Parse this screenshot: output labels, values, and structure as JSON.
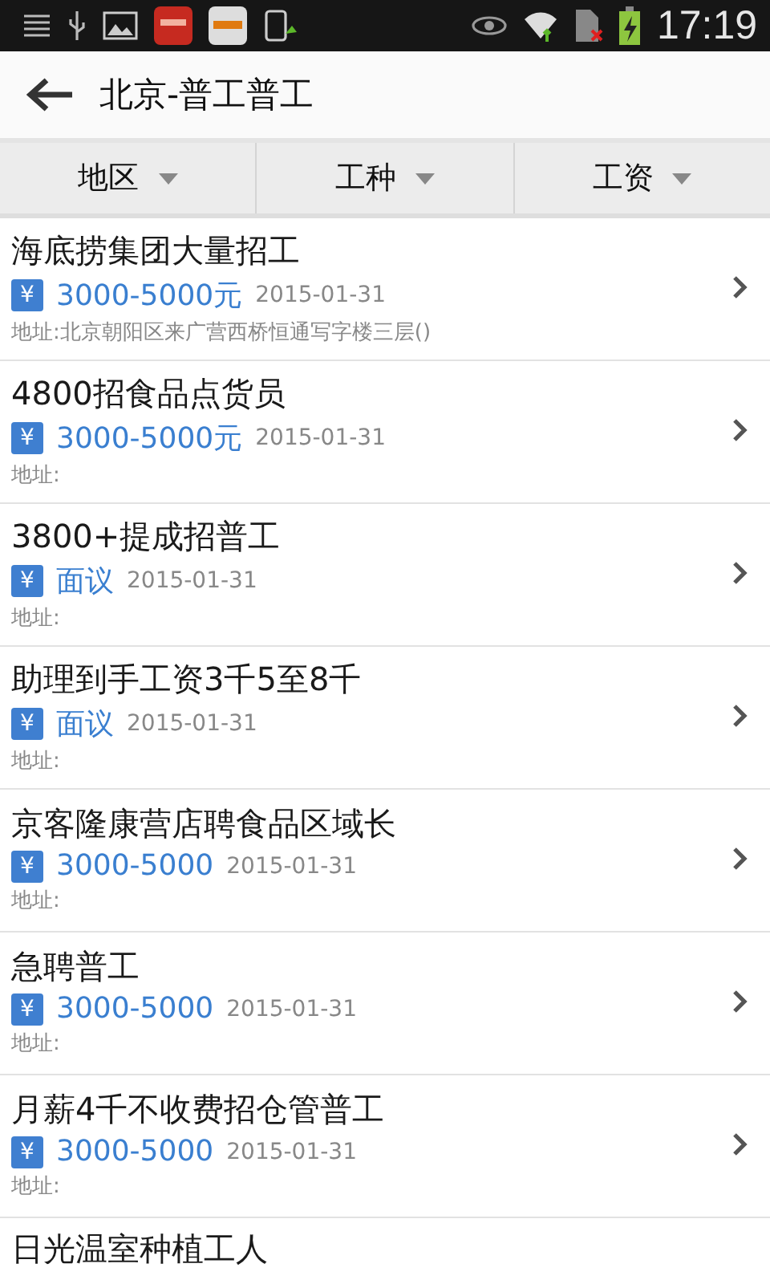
{
  "status_bar": {
    "time": "17:19"
  },
  "header": {
    "title": "北京-普工普工"
  },
  "filters": [
    {
      "label": "地区"
    },
    {
      "label": "工种"
    },
    {
      "label": "工资"
    }
  ],
  "jobs": [
    {
      "title": "海底捞集团大量招工",
      "badge": "¥",
      "salary": "3000-5000元",
      "date": "2015-01-31",
      "address": "地址:北京朝阳区来广营西桥恒通写字楼三层()"
    },
    {
      "title": "4800招食品点货员",
      "badge": "¥",
      "salary": "3000-5000元",
      "date": "2015-01-31",
      "address": "地址:"
    },
    {
      "title": "3800+提成招普工",
      "badge": "¥",
      "salary": "面议",
      "date": "2015-01-31",
      "address": "地址:"
    },
    {
      "title": "助理到手工资3千5至8千",
      "badge": "¥",
      "salary": "面议",
      "date": "2015-01-31",
      "address": "地址:"
    },
    {
      "title": "京客隆康营店聘食品区域长",
      "badge": "¥",
      "salary": "3000-5000",
      "date": "2015-01-31",
      "address": "地址:"
    },
    {
      "title": "急聘普工",
      "badge": "¥",
      "salary": "3000-5000",
      "date": "2015-01-31",
      "address": "地址:"
    },
    {
      "title": "月薪4千不收费招仓管普工",
      "badge": "¥",
      "salary": "3000-5000",
      "date": "2015-01-31",
      "address": "地址:"
    },
    {
      "title": "日光温室种植工人"
    }
  ]
}
